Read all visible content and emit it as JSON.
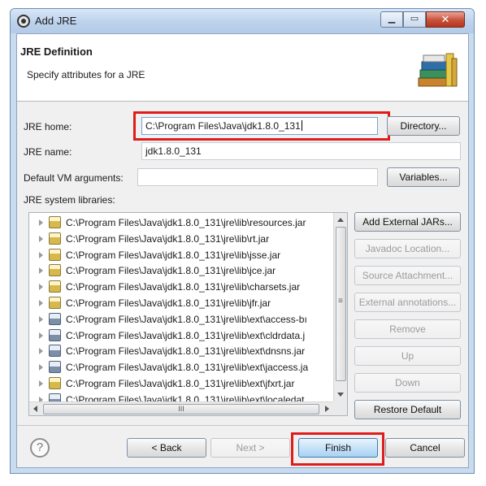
{
  "window": {
    "title": "Add JRE"
  },
  "header": {
    "title": "JRE Definition",
    "subtitle": "Specify attributes for a JRE"
  },
  "form": {
    "jre_home": {
      "label": "JRE home:",
      "value": "C:\\Program Files\\Java\\jdk1.8.0_131"
    },
    "jre_name": {
      "label": "JRE name:",
      "value": "jdk1.8.0_131"
    },
    "vm_args": {
      "label": "Default VM arguments:",
      "value": ""
    },
    "directory_button": "Directory...",
    "variables_button": "Variables..."
  },
  "libraries": {
    "label": "JRE system libraries:",
    "items": [
      {
        "path": "C:\\Program Files\\Java\\jdk1.8.0_131\\jre\\lib\\resources.jar",
        "icon": "jar-icon"
      },
      {
        "path": "C:\\Program Files\\Java\\jdk1.8.0_131\\jre\\lib\\rt.jar",
        "icon": "jar-icon"
      },
      {
        "path": "C:\\Program Files\\Java\\jdk1.8.0_131\\jre\\lib\\jsse.jar",
        "icon": "jar-icon"
      },
      {
        "path": "C:\\Program Files\\Java\\jdk1.8.0_131\\jre\\lib\\jce.jar",
        "icon": "jar-icon"
      },
      {
        "path": "C:\\Program Files\\Java\\jdk1.8.0_131\\jre\\lib\\charsets.jar",
        "icon": "jar-icon"
      },
      {
        "path": "C:\\Program Files\\Java\\jdk1.8.0_131\\jre\\lib\\jfr.jar",
        "icon": "jar-icon"
      },
      {
        "path": "C:\\Program Files\\Java\\jdk1.8.0_131\\jre\\lib\\ext\\access-bı",
        "icon": "ext-jar-icon"
      },
      {
        "path": "C:\\Program Files\\Java\\jdk1.8.0_131\\jre\\lib\\ext\\cldrdata.j",
        "icon": "ext-jar-icon"
      },
      {
        "path": "C:\\Program Files\\Java\\jdk1.8.0_131\\jre\\lib\\ext\\dnsns.jar",
        "icon": "ext-jar-icon"
      },
      {
        "path": "C:\\Program Files\\Java\\jdk1.8.0_131\\jre\\lib\\ext\\jaccess.ja",
        "icon": "ext-jar-icon"
      },
      {
        "path": "C:\\Program Files\\Java\\jdk1.8.0_131\\jre\\lib\\ext\\jfxrt.jar",
        "icon": "jar-icon"
      },
      {
        "path": "C:\\Program Files\\Java\\jdk1.8.0_131\\jre\\lib\\ext\\localedat",
        "icon": "ext-jar-icon"
      }
    ],
    "hscroll_grip": "III",
    "vscroll_grip": "≡"
  },
  "side_buttons": {
    "add_external_jars": "Add External JARs...",
    "javadoc_location": "Javadoc Location...",
    "source_attachment": "Source Attachment...",
    "external_annotations": "External annotations...",
    "remove": "Remove",
    "up": "Up",
    "down": "Down",
    "restore_default": "Restore Default"
  },
  "footer": {
    "help": "?",
    "back": "< Back",
    "next": "Next >",
    "finish": "Finish",
    "cancel": "Cancel"
  },
  "colors": {
    "highlight_box": "#e01b1b",
    "default_button": "#a9d2f3"
  }
}
